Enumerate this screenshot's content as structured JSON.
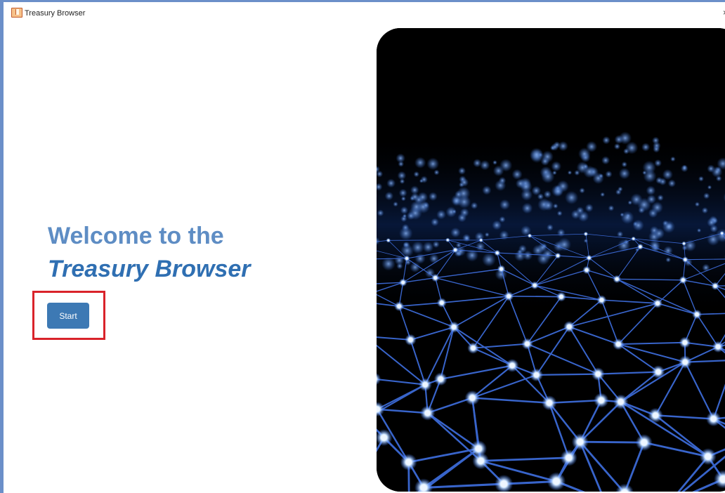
{
  "window": {
    "title": "Treasury Browser",
    "close_glyph": "×"
  },
  "welcome": {
    "line1": "Welcome to the",
    "line2": "Treasury Browser"
  },
  "start_button": {
    "label": "Start"
  },
  "colors": {
    "heading_light": "#5e8dc4",
    "heading_dark": "#2f6fb2",
    "button": "#3d79b4",
    "highlight": "#d9232a",
    "frame": "#6b8fc9"
  },
  "hero_image": {
    "icon": "network-mesh-image"
  }
}
